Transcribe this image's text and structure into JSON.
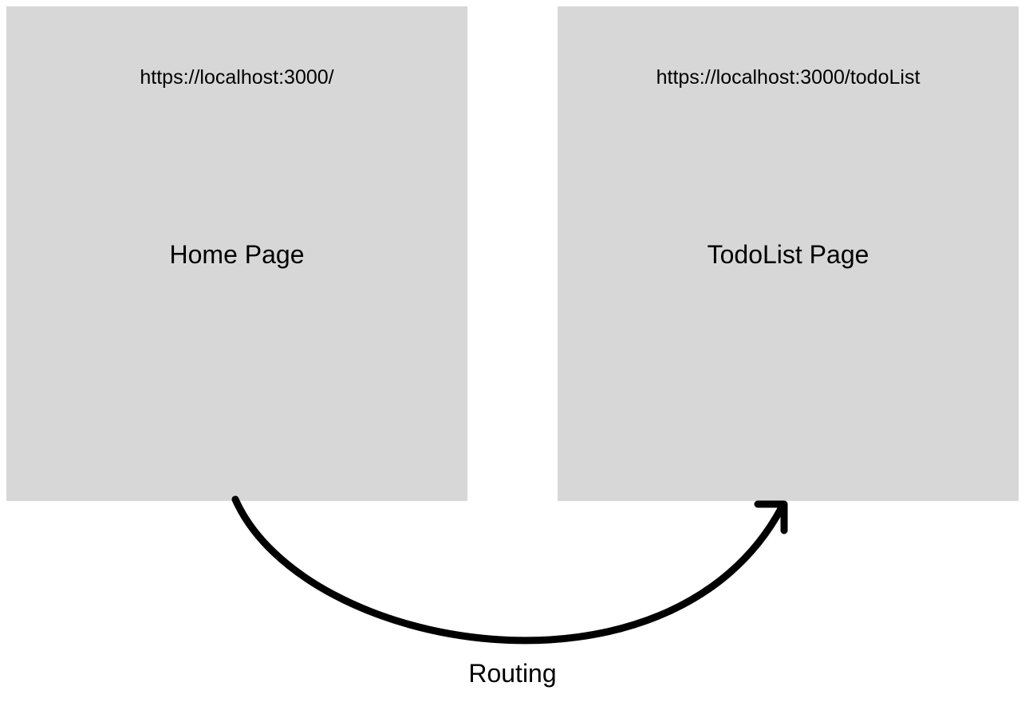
{
  "left_panel": {
    "url": "https://localhost:3000/",
    "title": "Home Page"
  },
  "right_panel": {
    "url": "https://localhost:3000/todoList",
    "title": "TodoList Page"
  },
  "arrow_label": "Routing"
}
